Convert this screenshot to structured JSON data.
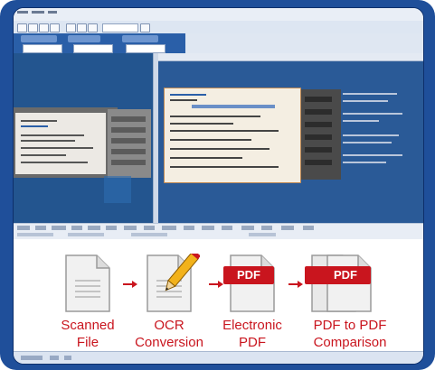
{
  "workflow": {
    "steps": [
      {
        "label_line1": "Scanned",
        "label_line2": "File"
      },
      {
        "label_line1": "OCR",
        "label_line2": "Conversion"
      },
      {
        "label_line1": "Electronic",
        "label_line2": "PDF",
        "badge": "PDF"
      },
      {
        "label_line1": "PDF to PDF",
        "label_line2": "Comparison",
        "badge": "PDF"
      }
    ]
  },
  "colors": {
    "frame": "#1f4f9a",
    "accent_red": "#c9151e",
    "pane_blue": "#2a5a97"
  },
  "icons": [
    "document-icon",
    "pencil-document-icon",
    "pdf-document-icon",
    "double-pdf-document-icon",
    "arrow-right-icon"
  ]
}
